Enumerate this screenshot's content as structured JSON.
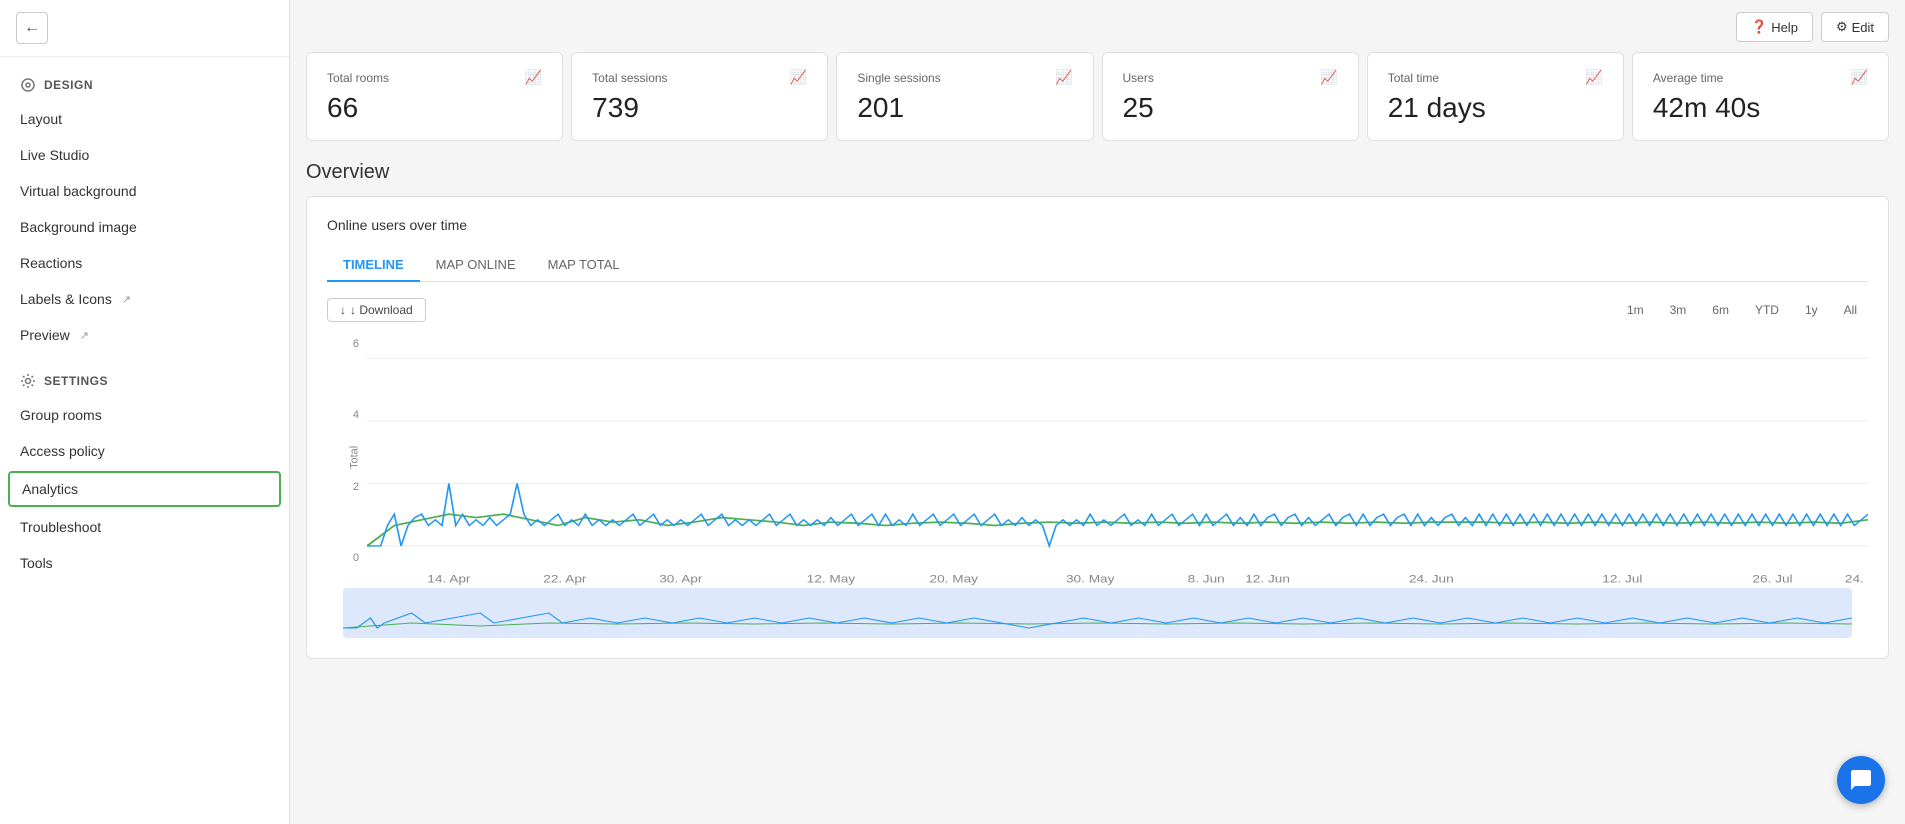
{
  "topbar": {
    "help_label": "Help",
    "edit_label": "Edit"
  },
  "sidebar": {
    "back_label": "←",
    "design_section": "DESIGN",
    "design_items": [
      {
        "id": "layout",
        "label": "Layout",
        "external": false
      },
      {
        "id": "live-studio",
        "label": "Live Studio",
        "external": false
      },
      {
        "id": "virtual-background",
        "label": "Virtual background",
        "external": false
      },
      {
        "id": "background-image",
        "label": "Background image",
        "external": false
      },
      {
        "id": "reactions",
        "label": "Reactions",
        "external": false
      },
      {
        "id": "labels-icons",
        "label": "Labels & Icons",
        "external": true
      },
      {
        "id": "preview",
        "label": "Preview",
        "external": true
      }
    ],
    "settings_section": "SETTINGS",
    "settings_items": [
      {
        "id": "group-rooms",
        "label": "Group rooms",
        "external": false
      },
      {
        "id": "access-policy",
        "label": "Access policy",
        "external": false
      },
      {
        "id": "analytics",
        "label": "Analytics",
        "external": false,
        "active": true
      },
      {
        "id": "troubleshoot",
        "label": "Troubleshoot",
        "external": false
      },
      {
        "id": "tools",
        "label": "Tools",
        "external": false
      }
    ]
  },
  "stats": [
    {
      "id": "total-rooms",
      "label": "Total rooms",
      "value": "66"
    },
    {
      "id": "total-sessions",
      "label": "Total sessions",
      "value": "739"
    },
    {
      "id": "single-sessions",
      "label": "Single sessions",
      "value": "201"
    },
    {
      "id": "users",
      "label": "Users",
      "value": "25"
    },
    {
      "id": "total-time",
      "label": "Total time",
      "value": "21 days"
    },
    {
      "id": "average-time",
      "label": "Average time",
      "value": "42m 40s"
    }
  ],
  "overview": {
    "title": "Overview",
    "chart_title": "Online users over time",
    "tabs": [
      {
        "id": "timeline",
        "label": "TIMELINE",
        "active": true
      },
      {
        "id": "map-online",
        "label": "MAP ONLINE",
        "active": false
      },
      {
        "id": "map-total",
        "label": "MAP TOTAL",
        "active": false
      }
    ],
    "download_label": "↓ Download",
    "time_filters": [
      {
        "id": "1m",
        "label": "1m"
      },
      {
        "id": "3m",
        "label": "3m"
      },
      {
        "id": "6m",
        "label": "6m"
      },
      {
        "id": "ytd",
        "label": "YTD"
      },
      {
        "id": "1y",
        "label": "1y"
      },
      {
        "id": "all",
        "label": "All"
      }
    ],
    "y_label": "Total",
    "x_labels": [
      "14. Apr",
      "22. Apr",
      "30. Apr",
      "12. May",
      "20. May",
      "30. May",
      "8. Jun",
      "12. Jun",
      "24. Jun",
      "12. Jul",
      "26. Jul",
      "24."
    ],
    "y_ticks": [
      "0",
      "2",
      "4",
      "6"
    ]
  }
}
